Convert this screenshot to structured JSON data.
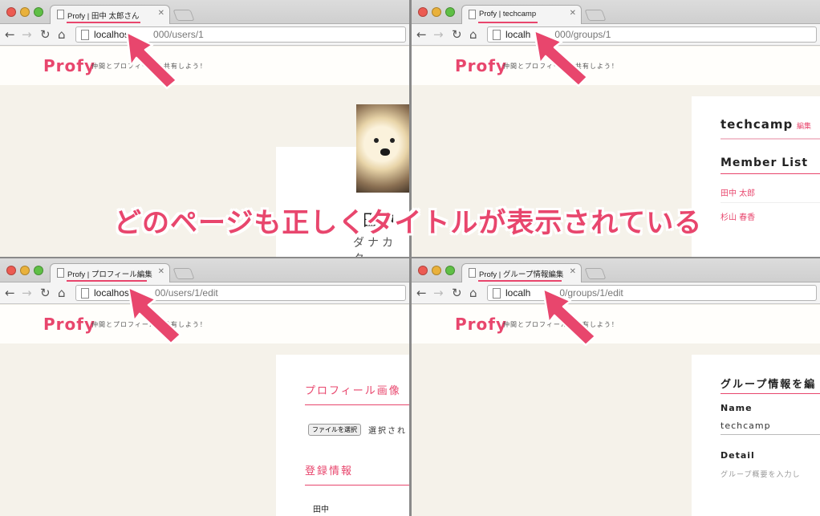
{
  "banner": "どのページも正しくタイトルが表示されている",
  "colors": {
    "accent": "#e8466d",
    "page_bg": "#f5f2ea"
  },
  "site": {
    "logo": "Profy",
    "tagline": "仲間とプロフィールを共有しよう！"
  },
  "windows": [
    {
      "tab_title": "Profy | 田中 太郎さん",
      "url_host": "localhos",
      "url_path": "000/users/1",
      "content": {
        "name": "田中",
        "kana": "ダナカ タ"
      }
    },
    {
      "tab_title": "Profy | techcamp",
      "url_host": "localh",
      "url_path": "000/groups/1",
      "content": {
        "group_name": "techcamp",
        "edit_link": "編集",
        "member_heading": "Member List",
        "members": [
          "田中 太郎",
          "杉山 春香"
        ]
      }
    },
    {
      "tab_title": "Profy | プロフィール編集",
      "url_host": "localhos",
      "url_path": "00/users/1/edit",
      "content": {
        "image_heading": "プロフィール画像",
        "file_button": "ファイルを選択",
        "file_status": "選択され",
        "info_heading": "登録情報",
        "name_value": "田中"
      }
    },
    {
      "tab_title": "Profy | グループ情報編集",
      "url_host": "localh",
      "url_path": "0/groups/1/edit",
      "content": {
        "heading": "グループ情報を編",
        "name_label": "Name",
        "name_value": "techcamp",
        "detail_label": "Detail",
        "detail_placeholder": "グループ概要を入力し"
      }
    }
  ]
}
